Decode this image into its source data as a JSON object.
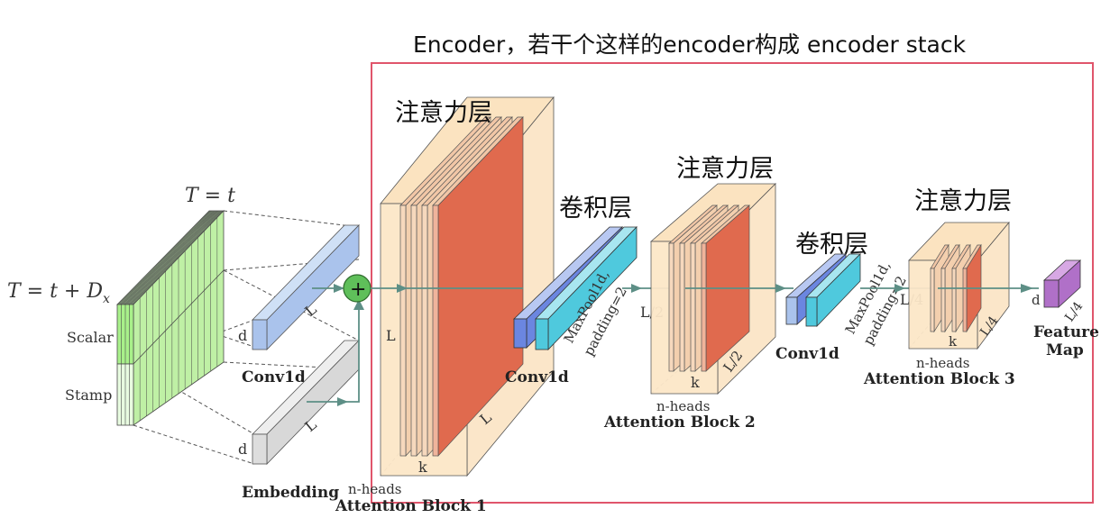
{
  "header": {
    "title": "Encoder，若干个这样的encoder构成 encoder stack"
  },
  "input": {
    "top_label": "T = t",
    "left_label": "T = t + D",
    "left_label_sub": "x",
    "scalar_label": "Scalar",
    "stamp_label": "Stamp"
  },
  "projections": {
    "conv_label": "Conv1d",
    "conv_d": "d",
    "conv_L": "L",
    "embed_label": "Embedding",
    "embed_d": "d",
    "embed_L": "L",
    "plus_symbol": "+"
  },
  "block1": {
    "zh_label": "注意力层",
    "caption": "Attention Block 1",
    "dim_L_left": "L",
    "dim_L_bottom": "L",
    "dim_k": "k",
    "dim_heads": "n-heads"
  },
  "conv1": {
    "zh_label": "卷积层",
    "caption": "Conv1d",
    "pool_line1": "MaxPool1d,",
    "pool_line2": "padding=2",
    "out_dim": "L/2"
  },
  "block2": {
    "zh_label": "注意力层",
    "caption": "Attention Block 2",
    "dim_k": "k",
    "dim_L": "L/2",
    "dim_heads": "n-heads"
  },
  "conv2": {
    "zh_label": "卷积层",
    "caption": "Conv1d",
    "pool_line1": "MaxPool1d,",
    "pool_line2": "padding=2",
    "out_dim": "L/4"
  },
  "block3": {
    "zh_label": "注意力层",
    "caption": "Attention Block 3",
    "dim_k": "k",
    "dim_L": "L/4",
    "dim_heads": "n-heads"
  },
  "output": {
    "caption_line1": "Feature",
    "caption_line2": "Map",
    "dim_d": "d",
    "dim_L": "L/4"
  },
  "colors": {
    "encoder_border": "#e0556b",
    "input_green": "#a8f08a",
    "conv_blue": "#aac3ec",
    "embed_gray": "#dddddd",
    "plus_green": "#5fbf5a",
    "block_bg": "#fce7c8",
    "attention_red": "#e06a4e",
    "conv_dark_blue": "#6b86e0",
    "conv_cyan": "#4fc9dd",
    "feature_purple": "#b070c8",
    "arrow": "#5d8f86"
  }
}
